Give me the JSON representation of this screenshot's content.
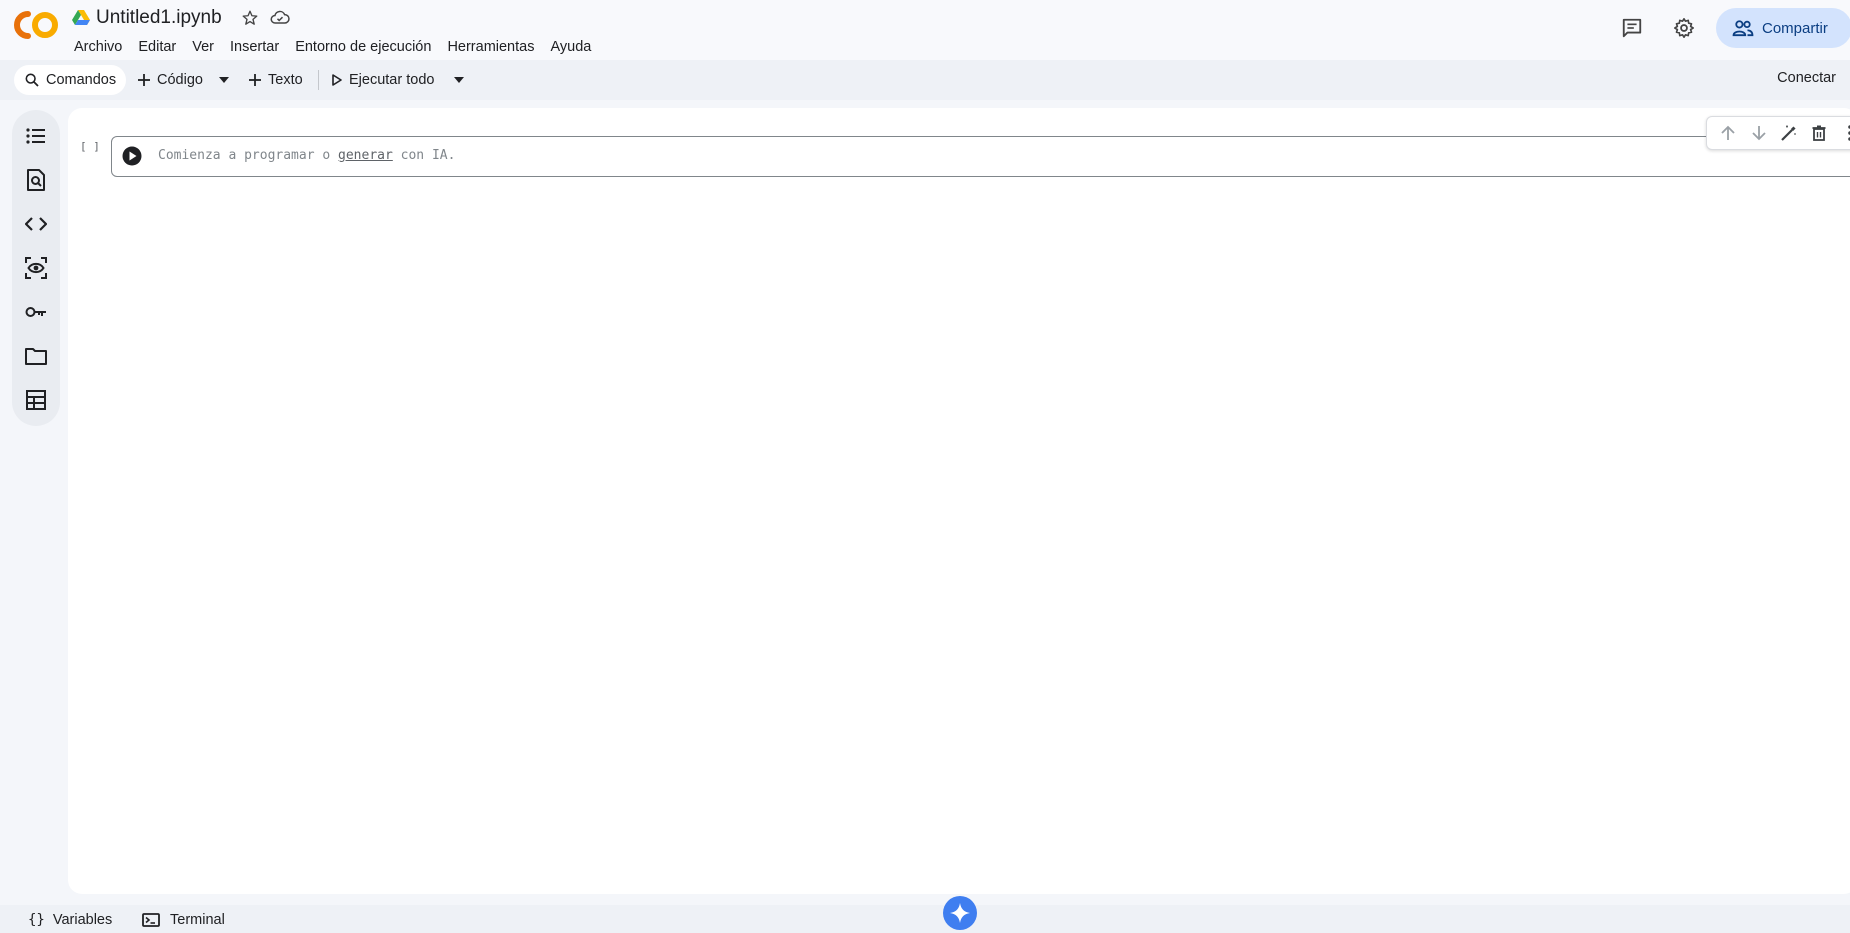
{
  "header": {
    "doc_title": "Untitled1.ipynb",
    "menu": [
      "Archivo",
      "Editar",
      "Ver",
      "Insertar",
      "Entorno de ejecución",
      "Herramientas",
      "Ayuda"
    ],
    "share_label": "Compartir"
  },
  "toolbar": {
    "commands_label": "Comandos",
    "code_label": "Código",
    "text_label": "Texto",
    "run_all_label": "Ejecutar todo",
    "connect_label": "Conectar"
  },
  "sidebar": {
    "icons": [
      "table-of-contents-icon",
      "find-replace-icon",
      "code-snippets-icon",
      "variables-inspector-icon",
      "secrets-key-icon",
      "files-folder-icon",
      "data-table-icon"
    ]
  },
  "cell": {
    "bracket": "[ ]",
    "placeholder_before": "Comienza a programar o ",
    "placeholder_link": "generar",
    "placeholder_after": " con IA."
  },
  "bottombar": {
    "variables_label": "Variables",
    "variables_icon_glyph": "{}",
    "terminal_label": "Terminal"
  },
  "colors": {
    "accent": "#3f7ef0",
    "share_bg": "#d3e3fd",
    "logo_orange": "#f9ab00",
    "logo_dark_orange": "#e8710a"
  }
}
